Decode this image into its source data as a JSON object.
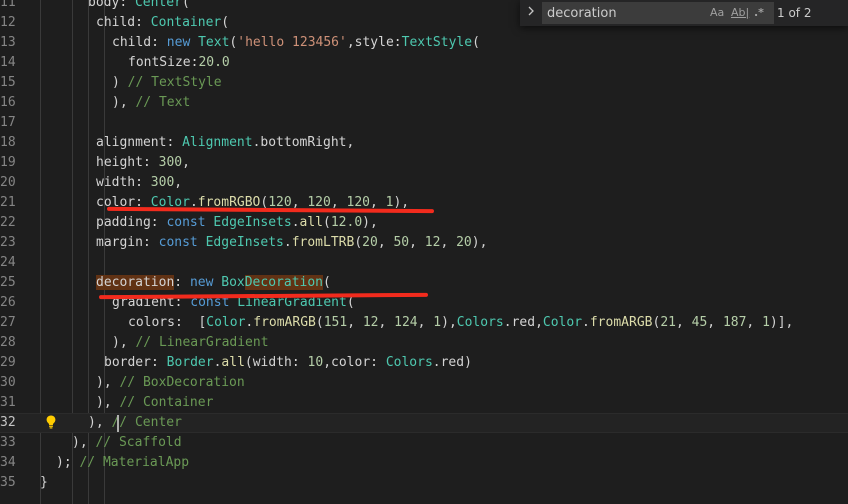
{
  "find": {
    "query": "decoration",
    "match_case_label": "Aa",
    "whole_word_label": "Ab|",
    "regex_label": ".*",
    "match_count": "1 of 2"
  },
  "lines": [
    {
      "num": "11",
      "indent": 6,
      "tokens": [
        [
          "prop",
          "body"
        ],
        [
          "pl",
          ": "
        ],
        [
          "cls",
          "Center"
        ],
        [
          "pl",
          "("
        ]
      ]
    },
    {
      "num": "12",
      "indent": 7,
      "tokens": [
        [
          "prop",
          "child"
        ],
        [
          "pl",
          ": "
        ],
        [
          "cls",
          "Container"
        ],
        [
          "pl",
          "("
        ]
      ]
    },
    {
      "num": "13",
      "indent": 9,
      "tokens": [
        [
          "prop",
          "child"
        ],
        [
          "pl",
          ": "
        ],
        [
          "kw",
          "new"
        ],
        [
          "pl",
          " "
        ],
        [
          "cls",
          "Text"
        ],
        [
          "pl",
          "("
        ],
        [
          "str",
          "'hello 123456'"
        ],
        [
          "pl",
          ",style:"
        ],
        [
          "cls",
          "TextStyle"
        ],
        [
          "pl",
          "("
        ]
      ]
    },
    {
      "num": "14",
      "indent": 11,
      "tokens": [
        [
          "prop",
          "fontSize"
        ],
        [
          "pl",
          ":"
        ],
        [
          "num",
          "20.0"
        ]
      ]
    },
    {
      "num": "15",
      "indent": 9,
      "tokens": [
        [
          "pl",
          ") "
        ],
        [
          "cmt",
          "// TextStyle"
        ]
      ]
    },
    {
      "num": "16",
      "indent": 9,
      "tokens": [
        [
          "pl",
          "), "
        ],
        [
          "cmt",
          "// Text"
        ]
      ]
    },
    {
      "num": "17",
      "indent": 0,
      "tokens": []
    },
    {
      "num": "18",
      "indent": 7,
      "tokens": [
        [
          "prop",
          "alignment"
        ],
        [
          "pl",
          ": "
        ],
        [
          "cls",
          "Alignment"
        ],
        [
          "pl",
          "."
        ],
        [
          "prop",
          "bottomRight"
        ],
        [
          "pl",
          ","
        ]
      ]
    },
    {
      "num": "19",
      "indent": 7,
      "tokens": [
        [
          "prop",
          "height"
        ],
        [
          "pl",
          ": "
        ],
        [
          "num",
          "300"
        ],
        [
          "pl",
          ","
        ]
      ]
    },
    {
      "num": "20",
      "indent": 7,
      "tokens": [
        [
          "prop",
          "width"
        ],
        [
          "pl",
          ": "
        ],
        [
          "num",
          "300"
        ],
        [
          "pl",
          ","
        ]
      ]
    },
    {
      "num": "21",
      "indent": 7,
      "tokens": [
        [
          "prop",
          "color"
        ],
        [
          "pl",
          ": "
        ],
        [
          "cls",
          "Color"
        ],
        [
          "pl",
          "."
        ],
        [
          "fn",
          "fromRGBO"
        ],
        [
          "pl",
          "("
        ],
        [
          "num",
          "120"
        ],
        [
          "pl",
          ", "
        ],
        [
          "num",
          "120"
        ],
        [
          "pl",
          ", "
        ],
        [
          "num",
          "120"
        ],
        [
          "pl",
          ", "
        ],
        [
          "num",
          "1"
        ],
        [
          "pl",
          "),"
        ]
      ]
    },
    {
      "num": "22",
      "indent": 7,
      "tokens": [
        [
          "prop",
          "padding"
        ],
        [
          "pl",
          ": "
        ],
        [
          "kw",
          "const"
        ],
        [
          "pl",
          " "
        ],
        [
          "cls",
          "EdgeInsets"
        ],
        [
          "pl",
          "."
        ],
        [
          "fn",
          "all"
        ],
        [
          "pl",
          "("
        ],
        [
          "num",
          "12.0"
        ],
        [
          "pl",
          "),"
        ]
      ]
    },
    {
      "num": "23",
      "indent": 7,
      "tokens": [
        [
          "prop",
          "margin"
        ],
        [
          "pl",
          ": "
        ],
        [
          "kw",
          "const"
        ],
        [
          "pl",
          " "
        ],
        [
          "cls",
          "EdgeInsets"
        ],
        [
          "pl",
          "."
        ],
        [
          "fn",
          "fromLTRB"
        ],
        [
          "pl",
          "("
        ],
        [
          "num",
          "20"
        ],
        [
          "pl",
          ", "
        ],
        [
          "num",
          "50"
        ],
        [
          "pl",
          ", "
        ],
        [
          "num",
          "12"
        ],
        [
          "pl",
          ", "
        ],
        [
          "num",
          "20"
        ],
        [
          "pl",
          "),"
        ]
      ]
    },
    {
      "num": "24",
      "indent": 0,
      "tokens": []
    },
    {
      "num": "25",
      "indent": 7,
      "tokens": [
        [
          "hlprop",
          "decoration"
        ],
        [
          "pl",
          ": "
        ],
        [
          "kw",
          "new"
        ],
        [
          "pl",
          " "
        ],
        [
          "cls",
          "Box"
        ],
        [
          "hlcls",
          "Decoration"
        ],
        [
          "pl",
          "("
        ]
      ]
    },
    {
      "num": "26",
      "indent": 9,
      "tokens": [
        [
          "prop",
          "gradient"
        ],
        [
          "pl",
          ": "
        ],
        [
          "kw",
          "const"
        ],
        [
          "pl",
          " "
        ],
        [
          "cls",
          "LinearGradient"
        ],
        [
          "pl",
          "("
        ]
      ]
    },
    {
      "num": "27",
      "indent": 11,
      "tokens": [
        [
          "prop",
          "colors"
        ],
        [
          "pl",
          ":  ["
        ],
        [
          "cls",
          "Color"
        ],
        [
          "pl",
          "."
        ],
        [
          "fn",
          "fromARGB"
        ],
        [
          "pl",
          "("
        ],
        [
          "num",
          "151"
        ],
        [
          "pl",
          ", "
        ],
        [
          "num",
          "12"
        ],
        [
          "pl",
          ", "
        ],
        [
          "num",
          "124"
        ],
        [
          "pl",
          ", "
        ],
        [
          "num",
          "1"
        ],
        [
          "pl",
          "),"
        ],
        [
          "cls",
          "Colors"
        ],
        [
          "pl",
          "."
        ],
        [
          "prop",
          "red"
        ],
        [
          "pl",
          ","
        ],
        [
          "cls",
          "Color"
        ],
        [
          "pl",
          "."
        ],
        [
          "fn",
          "fromARGB"
        ],
        [
          "pl",
          "("
        ],
        [
          "num",
          "21"
        ],
        [
          "pl",
          ", "
        ],
        [
          "num",
          "45"
        ],
        [
          "pl",
          ", "
        ],
        [
          "num",
          "187"
        ],
        [
          "pl",
          ", "
        ],
        [
          "num",
          "1"
        ],
        [
          "pl",
          ")],"
        ]
      ]
    },
    {
      "num": "28",
      "indent": 9,
      "tokens": [
        [
          "pl",
          "), "
        ],
        [
          "cmt",
          "// LinearGradient"
        ]
      ]
    },
    {
      "num": "29",
      "indent": 8,
      "tokens": [
        [
          "prop",
          "border"
        ],
        [
          "pl",
          ": "
        ],
        [
          "cls",
          "Border"
        ],
        [
          "pl",
          "."
        ],
        [
          "fn",
          "all"
        ],
        [
          "pl",
          "("
        ],
        [
          "prop",
          "width"
        ],
        [
          "pl",
          ": "
        ],
        [
          "num",
          "10"
        ],
        [
          "pl",
          ","
        ],
        [
          "prop",
          "color"
        ],
        [
          "pl",
          ": "
        ],
        [
          "cls",
          "Colors"
        ],
        [
          "pl",
          "."
        ],
        [
          "prop",
          "red"
        ],
        [
          "pl",
          ")"
        ]
      ]
    },
    {
      "num": "30",
      "indent": 7,
      "tokens": [
        [
          "pl",
          "), "
        ],
        [
          "cmt",
          "// BoxDecoration"
        ]
      ]
    },
    {
      "num": "31",
      "indent": 7,
      "tokens": [
        [
          "pl",
          "), "
        ],
        [
          "cmt",
          "// Container"
        ]
      ]
    },
    {
      "num": "32",
      "indent": 6,
      "tokens": [
        [
          "pl",
          "), "
        ],
        [
          "cmt",
          "// Center"
        ]
      ]
    },
    {
      "num": "33",
      "indent": 4,
      "tokens": [
        [
          "pl",
          "), "
        ],
        [
          "cmt",
          "// Scaffold"
        ]
      ]
    },
    {
      "num": "34",
      "indent": 2,
      "tokens": [
        [
          "pl",
          "); "
        ],
        [
          "cmt",
          "// MaterialApp"
        ]
      ]
    },
    {
      "num": "35",
      "indent": 0,
      "tokens": [
        [
          "pl",
          "}"
        ]
      ]
    }
  ],
  "current_line": "32",
  "colors": {
    "background": "#1e1e1e",
    "keyword": "#569cd6",
    "class": "#4ec9b0",
    "function": "#dcdcaa",
    "string": "#ce9178",
    "number": "#b5cea8",
    "comment": "#6a9955",
    "find_highlight": "#613214",
    "annotation_red": "#f22b1d"
  },
  "icons": {
    "find_toggle": "chevron-right-icon",
    "lightbulb": "lightbulb-icon"
  }
}
